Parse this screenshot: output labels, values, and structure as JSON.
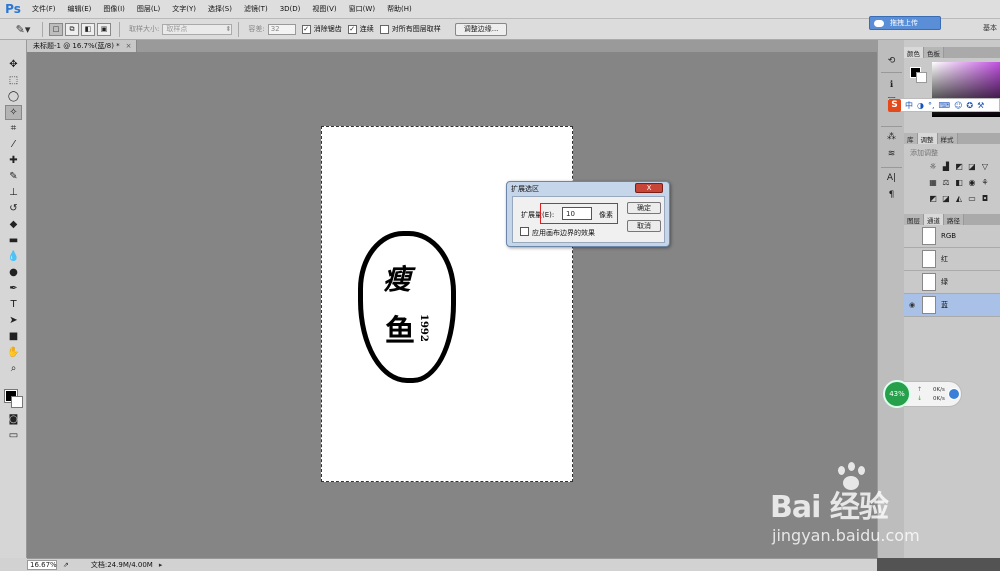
{
  "app": {
    "logo": "Ps"
  },
  "menu": [
    "文件(F)",
    "编辑(E)",
    "图像(I)",
    "图层(L)",
    "文字(Y)",
    "选择(S)",
    "滤镜(T)",
    "3D(D)",
    "视图(V)",
    "窗口(W)",
    "帮助(H)"
  ],
  "topright": {
    "upload": "拖拽上传",
    "workspace": "基本"
  },
  "options": {
    "sample_size_label": "取样大小:",
    "sample_size_value": "取样点",
    "tolerance_label": "容差:",
    "tolerance_value": "32",
    "antialias": "消除锯齿",
    "contiguous": "连续",
    "all_layers": "对所有图层取样",
    "refine_edge": "调整边缘..."
  },
  "document_tab": {
    "title": "未标题-1 @ 16.7%(蓝/8) *",
    "close": "×"
  },
  "artwork": {
    "char1": "瘦",
    "char2": "鱼",
    "year": "1992"
  },
  "dialog": {
    "title": "扩展选区",
    "close": "X",
    "expand_label": "扩展量(E):",
    "expand_value": "10",
    "unit": "像素",
    "apply_canvas": "应用画布边界的效果",
    "ok": "确定",
    "cancel": "取消"
  },
  "panels": {
    "color_tabs": [
      "颜色",
      "色板"
    ],
    "adjust_tabs": [
      "库",
      "调整",
      "样式"
    ],
    "adjust_title": "添加调整",
    "layer_tabs": [
      "图层",
      "通道",
      "路径"
    ],
    "channels": [
      {
        "name": "RGB"
      },
      {
        "name": "红"
      },
      {
        "name": "绿"
      },
      {
        "name": "蓝"
      }
    ],
    "ime": {
      "logo": "S",
      "mode": "中"
    }
  },
  "network": {
    "percent": "43%",
    "up": "0K/s",
    "down": "0K/s"
  },
  "status": {
    "zoom": "16.67%",
    "doc": "文档:24.9M/4.00M"
  },
  "watermark": {
    "brand": "Bai  经验",
    "url": "jingyan.baidu.com"
  }
}
